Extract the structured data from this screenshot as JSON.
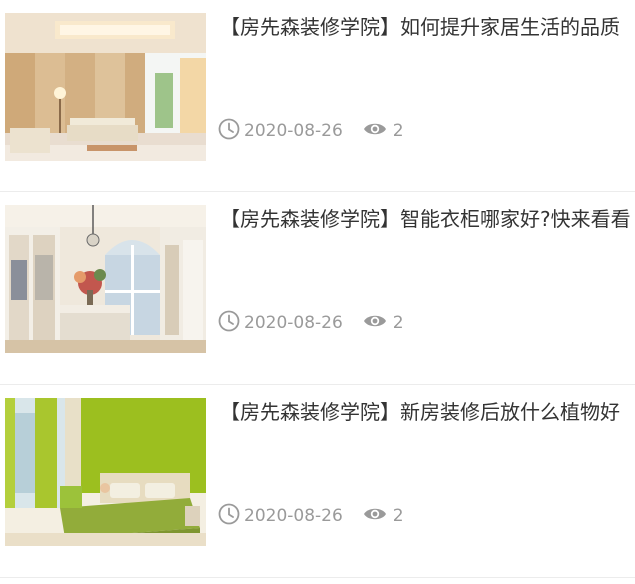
{
  "articles": [
    {
      "title": "【房先森装修学院】如何提升家居生活的品质",
      "date": "2020-08-26",
      "views": "2",
      "thumb_scene": "living-room"
    },
    {
      "title": "【房先森装修学院】智能衣柜哪家好?快来看看",
      "date": "2020-08-26",
      "views": "2",
      "thumb_scene": "walk-in-closet"
    },
    {
      "title": "【房先森装修学院】新房装修后放什么植物好",
      "date": "2020-08-26",
      "views": "2",
      "thumb_scene": "green-bedroom"
    }
  ],
  "icons": {
    "date": "clock-icon",
    "views": "eye-icon"
  },
  "colors": {
    "title": "#333333",
    "meta": "#9a9a9a",
    "divider": "#ececec"
  }
}
